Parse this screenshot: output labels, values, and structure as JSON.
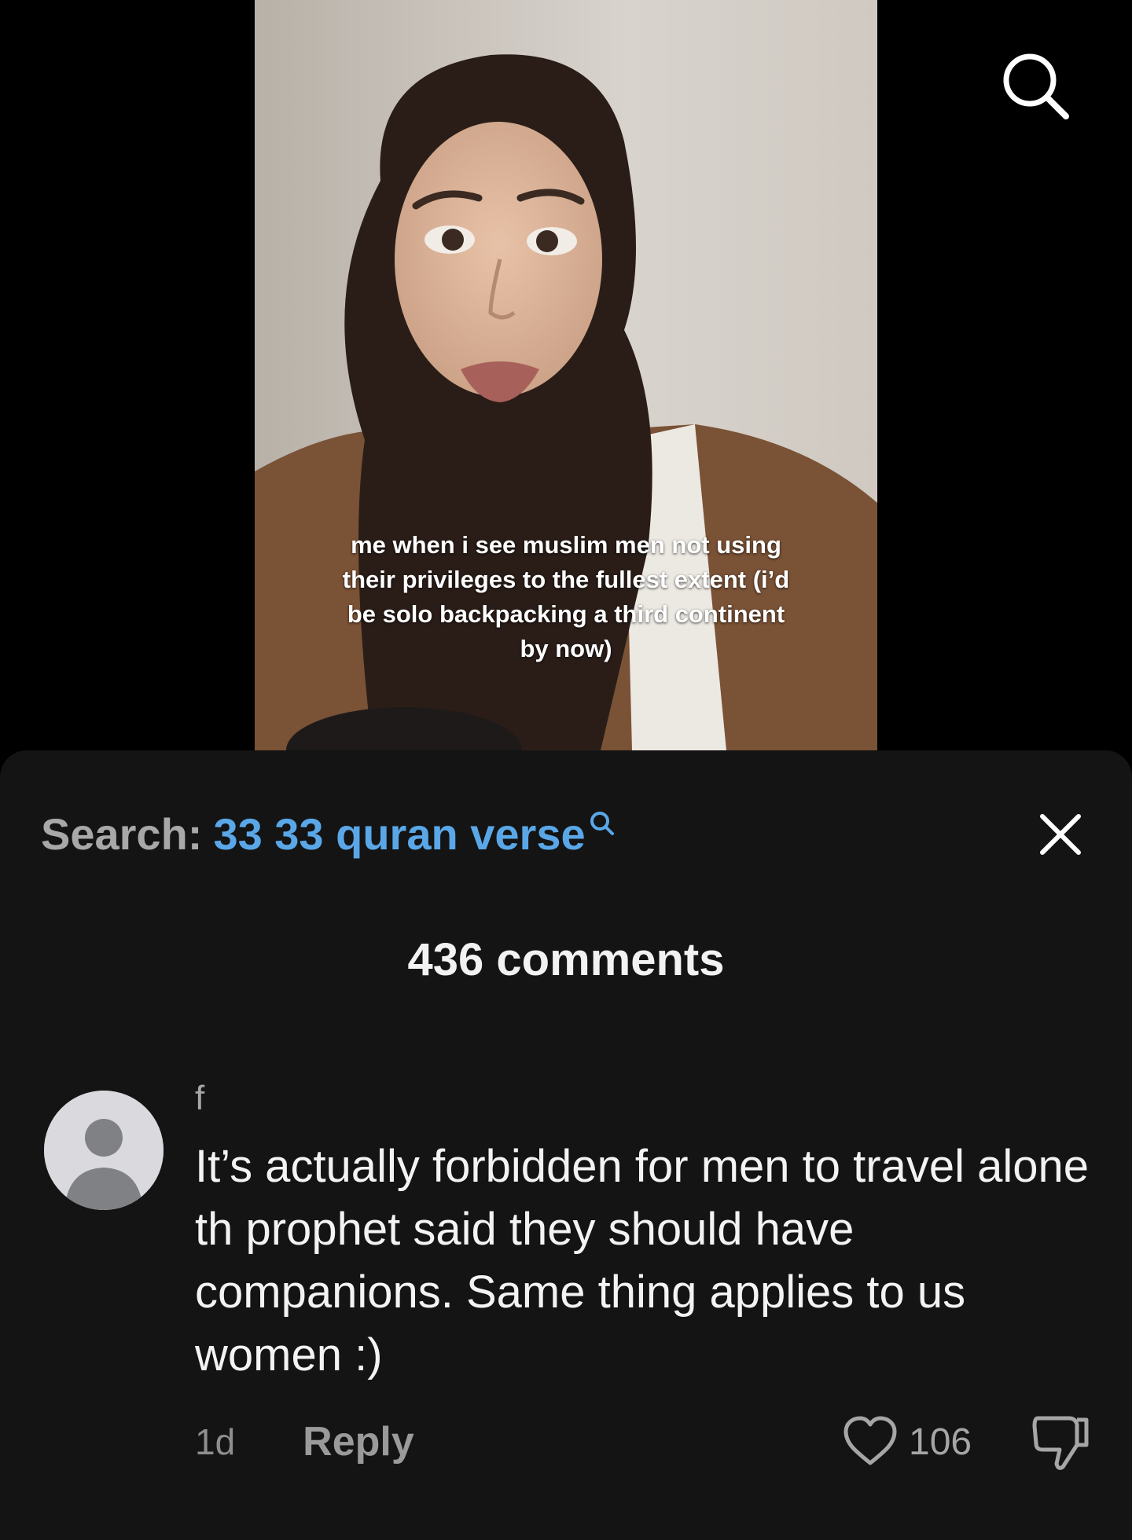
{
  "video": {
    "caption": "me when i see muslim men not using their privileges to the fullest extent (i’d be solo backpacking a third continent by now)"
  },
  "search_bar": {
    "label": "Search:",
    "query": "33 33 quran verse"
  },
  "comments_panel": {
    "count_text": "436 comments"
  },
  "comment": {
    "username": "f",
    "text": "It’s actually forbidden for men to travel alone th prophet said they should have companions. Same thing applies to us women :)",
    "timestamp": "1d",
    "reply_label": "Reply",
    "like_count": "106"
  },
  "colors": {
    "sheet_background": "#141414",
    "search_query": "#5aa7e8",
    "primary_text": "#f3f3f3",
    "secondary_text": "#a6a6a6"
  },
  "icons": [
    "search-icon",
    "close-icon",
    "avatar-placeholder-icon",
    "heart-icon",
    "thumbs-down-icon"
  ]
}
